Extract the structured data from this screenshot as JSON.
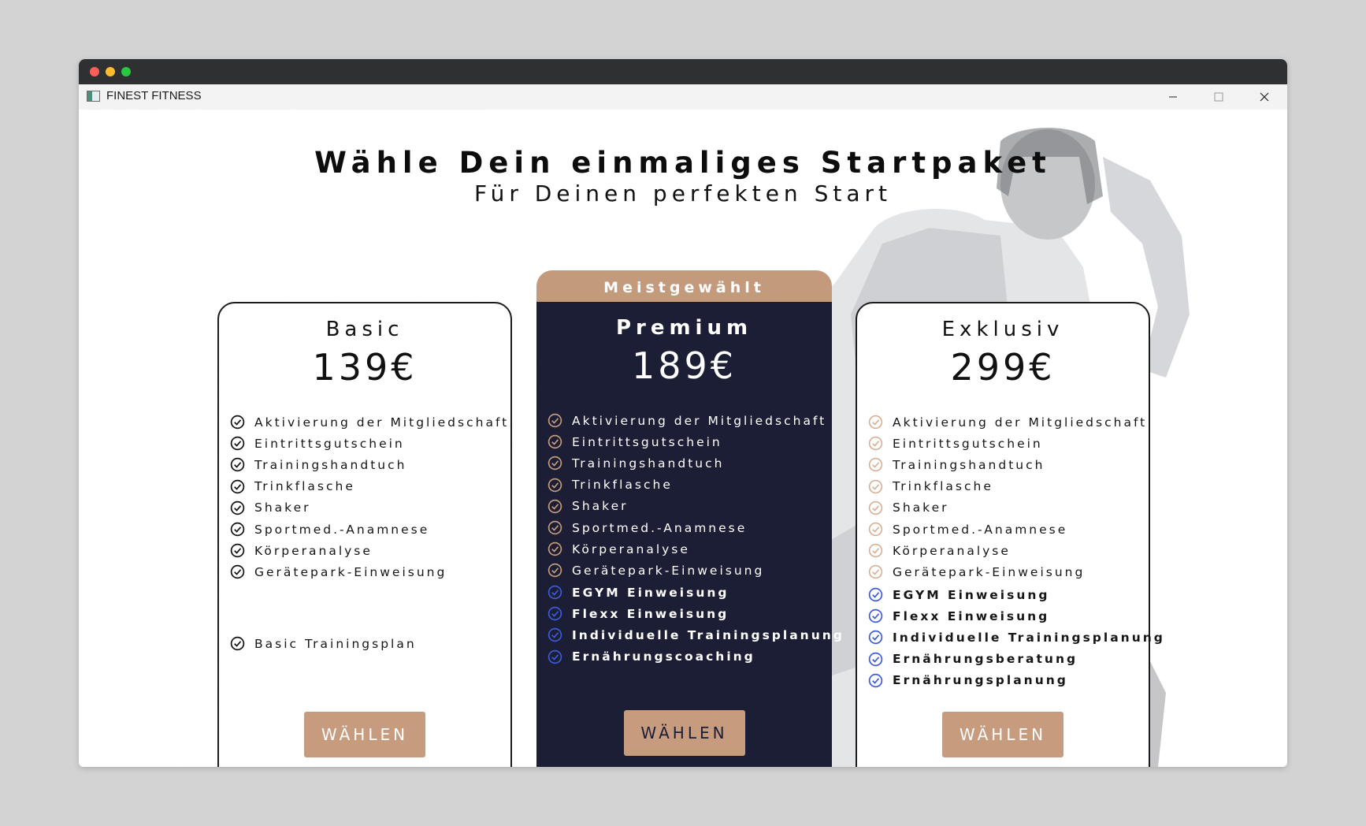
{
  "window": {
    "title": "FINEST FITNESS",
    "controls": {
      "minimize": "minimize-icon",
      "maximize": "maximize-icon",
      "close": "close-icon"
    }
  },
  "colors": {
    "dark_card": "#1b1e35",
    "accent_tan": "#c79b7d",
    "check_blue": "#3d5bd9",
    "check_tan": "#c49a7c"
  },
  "hero": {
    "headline": "Wähle Dein einmaliges Startpaket",
    "subheadline": "Für Deinen perfekten Start"
  },
  "plans": [
    {
      "name": "Basic",
      "price": "139€",
      "features": [
        "Aktivierung der Mitgliedschaft",
        "Eintrittsgutschein",
        "Trainingshandtuch",
        "Trinkflasche",
        "Shaker",
        "Sportmed.-Anamnese",
        "Körperanalyse",
        "Gerätepark-Einweisung"
      ],
      "extras": [
        "Basic Trainingsplan"
      ],
      "button": "WÄHLEN"
    },
    {
      "name": "Premium",
      "badge": "Meistgewählt",
      "price": "189€",
      "features": [
        "Aktivierung der Mitgliedschaft",
        "Eintrittsgutschein",
        "Trainingshandtuch",
        "Trinkflasche",
        "Shaker",
        "Sportmed.-Anamnese",
        "Körperanalyse",
        "Gerätepark-Einweisung"
      ],
      "extras": [
        "EGYM Einweisung",
        "Flexx Einweisung",
        "Individuelle Trainingsplanung",
        "Ernährungscoaching"
      ],
      "button": "WÄHLEN"
    },
    {
      "name": "Exklusiv",
      "price": "299€",
      "features": [
        "Aktivierung der Mitgliedschaft",
        "Eintrittsgutschein",
        "Trainingshandtuch",
        "Trinkflasche",
        "Shaker",
        "Sportmed.-Anamnese",
        "Körperanalyse",
        "Gerätepark-Einweisung"
      ],
      "extras": [
        "EGYM Einweisung",
        "Flexx Einweisung",
        "Individuelle Trainingsplanung",
        "Ernährungsberatung",
        "Ernährungsplanung"
      ],
      "button": "WÄHLEN"
    }
  ]
}
